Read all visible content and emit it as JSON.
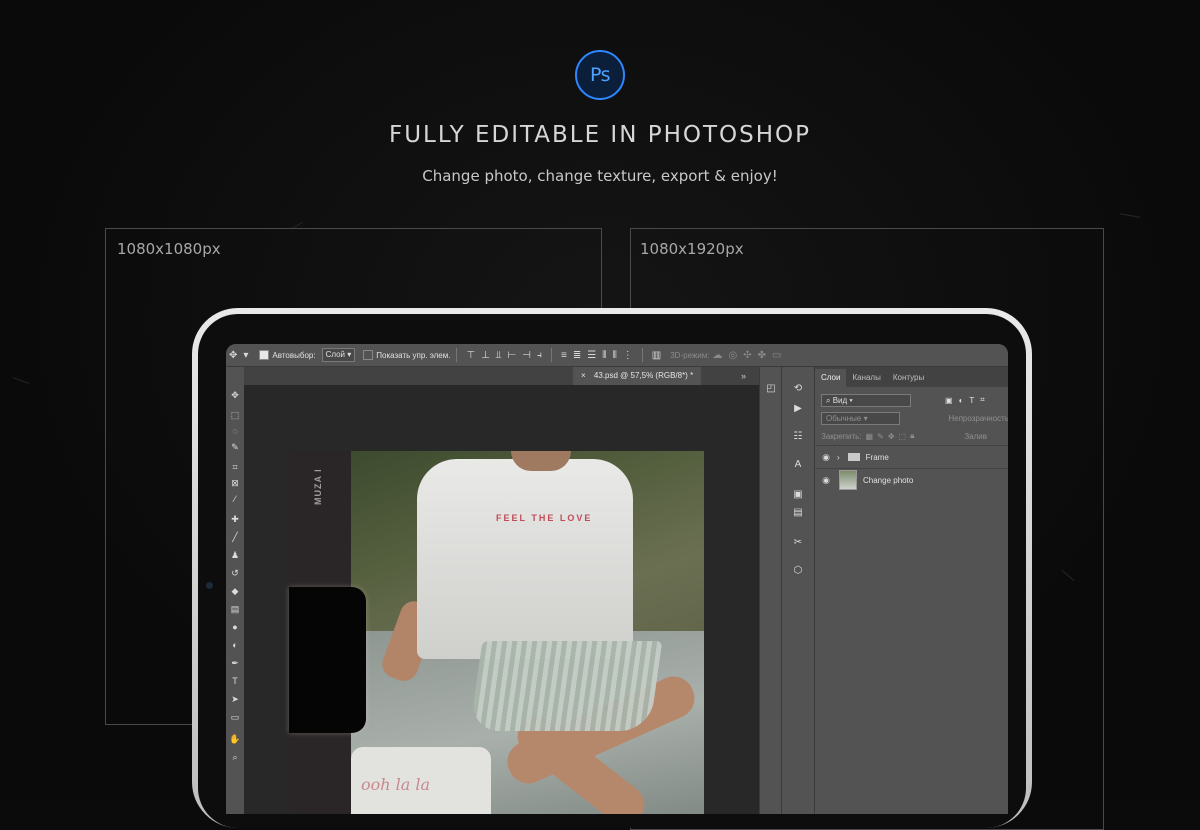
{
  "hero": {
    "app_logo": "Ps",
    "headline": "FULLY EDITABLE IN PHOTOSHOP",
    "subline": "Change photo, change texture, export & enjoy!",
    "frames": [
      {
        "label": "1080x1080px"
      },
      {
        "label": "1080x1920px"
      }
    ]
  },
  "photoshop": {
    "options_bar": {
      "move_icon": "move-tool-icon",
      "auto_select_label": "Автовыбор:",
      "auto_select_checked": true,
      "auto_select_value": "Слой",
      "show_controls_label": "Показать упр. элем.",
      "show_controls_checked": false,
      "mode_3d_label": "3D-режим:"
    },
    "document_tab": "43.psd @ 57,5% (RGB/8*) *",
    "canvas": {
      "strip_text": "MUZA I",
      "shirt_text": "FEEL THE LOVE",
      "tee_text": "ooh la la"
    },
    "layers_panel": {
      "tabs": [
        "Слои",
        "Каналы",
        "Контуры"
      ],
      "active_tab": "Слои",
      "filter_label": "Вид",
      "blend_mode": "Обычные",
      "opacity_label": "Непрозрачность",
      "lock_label": "Закрепить:",
      "fill_label": "Залив",
      "layers": [
        {
          "name": "Frame",
          "type": "group",
          "visible": true
        },
        {
          "name": "Change photo",
          "type": "image",
          "visible": true
        }
      ]
    }
  }
}
